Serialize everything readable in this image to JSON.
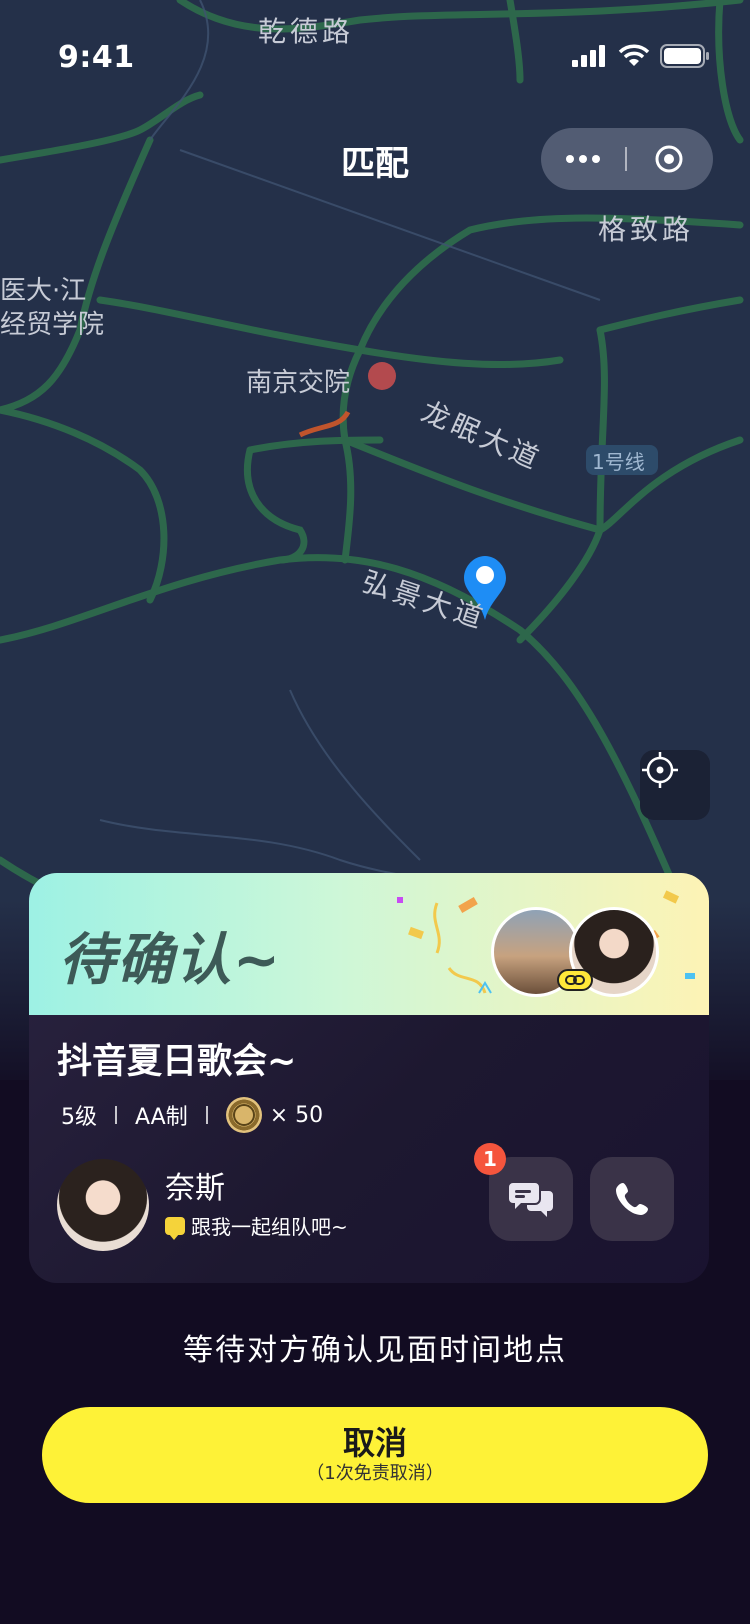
{
  "status_bar": {
    "time": "9:41"
  },
  "nav": {
    "title": "匹配"
  },
  "map": {
    "labels": {
      "qiande": "乾德路",
      "gezhi": "格致路",
      "yida": "医大·江",
      "jingmao": "经贸学院",
      "nanjing_jiaoyuan": "南京交院",
      "longmian": "龙眠大道",
      "line1": "1号线",
      "hongjing": "弘景大道"
    }
  },
  "card": {
    "status_title": "待确认~",
    "event_title": "抖音夏日歌会~",
    "level": "5级",
    "payment": "AA制",
    "coin_text": "× 50",
    "user": {
      "name": "奈斯",
      "message": "跟我一起组队吧~"
    },
    "chat_badge": "1"
  },
  "wait_text": "等待对方确认见面时间地点",
  "cancel": {
    "label": "取消",
    "sub": "（1次免责取消）"
  },
  "colors": {
    "accent_yellow": "#fef237",
    "map_bg": "#243049",
    "road": "#2f6e4c",
    "card_head_start": "#9df1e4",
    "card_head_end": "#fdf3b5",
    "badge_red": "#f5553d"
  }
}
